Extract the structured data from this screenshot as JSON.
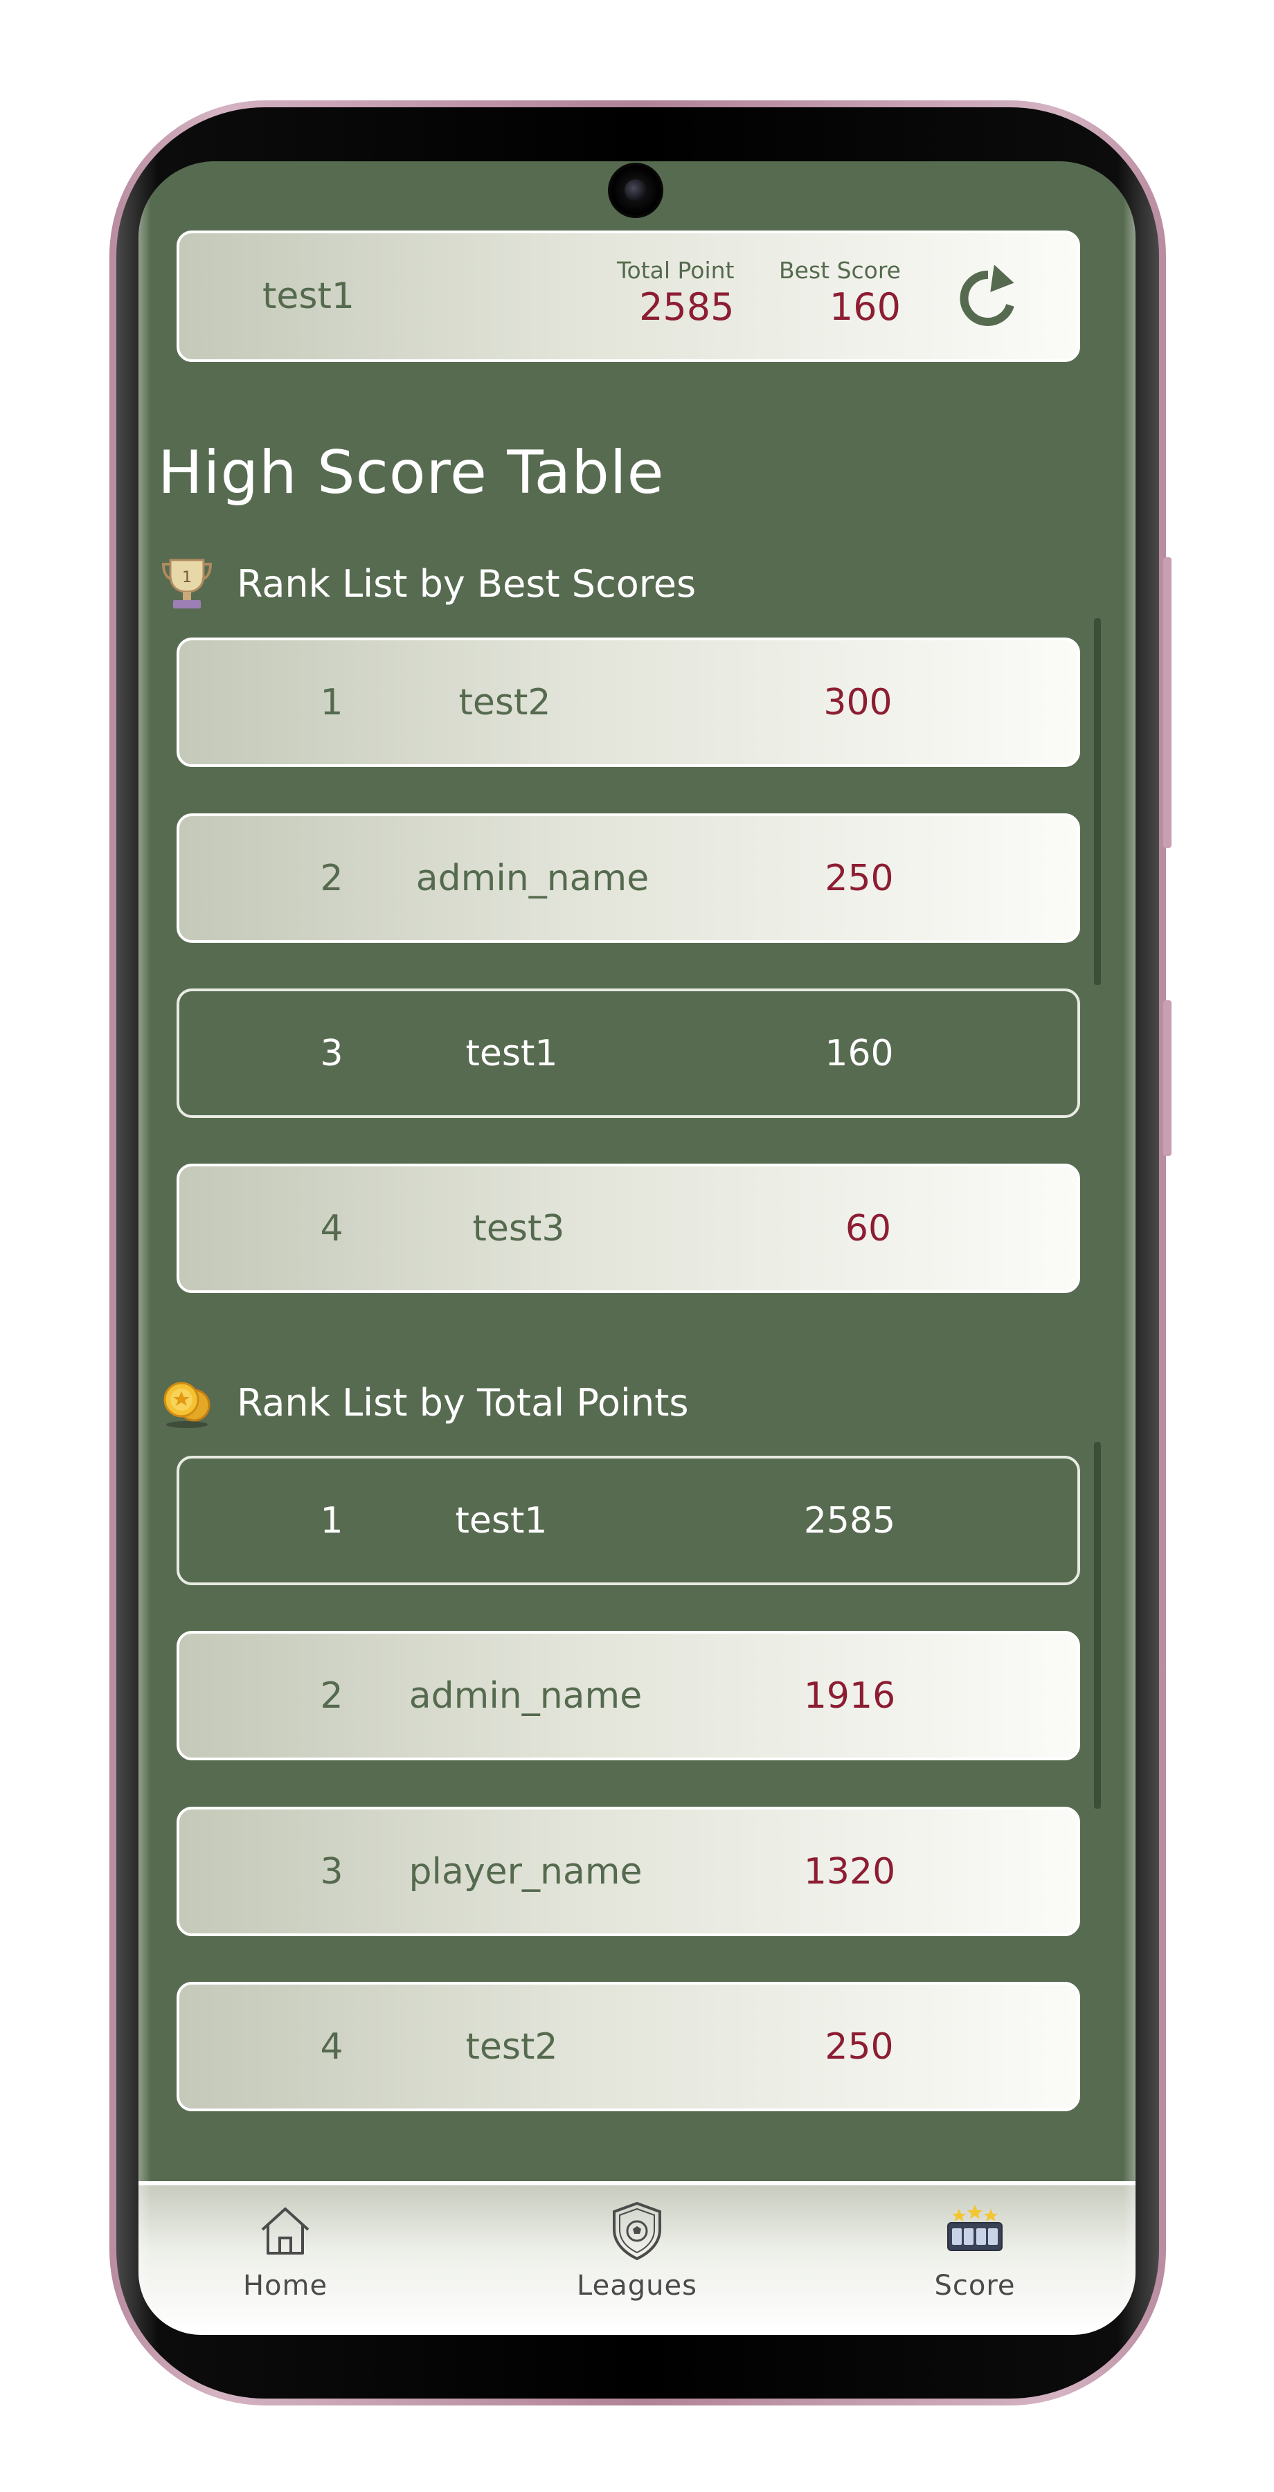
{
  "header": {
    "username": "test1",
    "total_point_label": "Total Point",
    "total_point_value": "2585",
    "best_score_label": "Best Score",
    "best_score_value": "160",
    "refresh_icon": "refresh-icon"
  },
  "page_title": "High Score Table",
  "best_scores": {
    "title": "Rank List by Best Scores",
    "icon": "trophy-icon",
    "rows": [
      {
        "rank": "1",
        "name": "test2",
        "score": "300"
      },
      {
        "rank": "2",
        "name": "admin_name",
        "score": "250"
      },
      {
        "rank": "3",
        "name": "test1",
        "score": "160"
      },
      {
        "rank": "4",
        "name": "test3",
        "score": "60"
      }
    ]
  },
  "total_points": {
    "title": "Rank List by Total Points",
    "icon": "coins-icon",
    "rows": [
      {
        "rank": "1",
        "name": "test1",
        "score": "2585"
      },
      {
        "rank": "2",
        "name": "admin_name",
        "score": "1916"
      },
      {
        "rank": "3",
        "name": "player_name",
        "score": "1320"
      },
      {
        "rank": "4",
        "name": "test2",
        "score": "250"
      }
    ]
  },
  "nav": {
    "home": "Home",
    "leagues": "Leagues",
    "score": "Score"
  },
  "colors": {
    "background": "#576b50",
    "score_text": "#8c1d33",
    "muted_green_text": "#556a4e",
    "highlight_text": "#ffffff"
  }
}
